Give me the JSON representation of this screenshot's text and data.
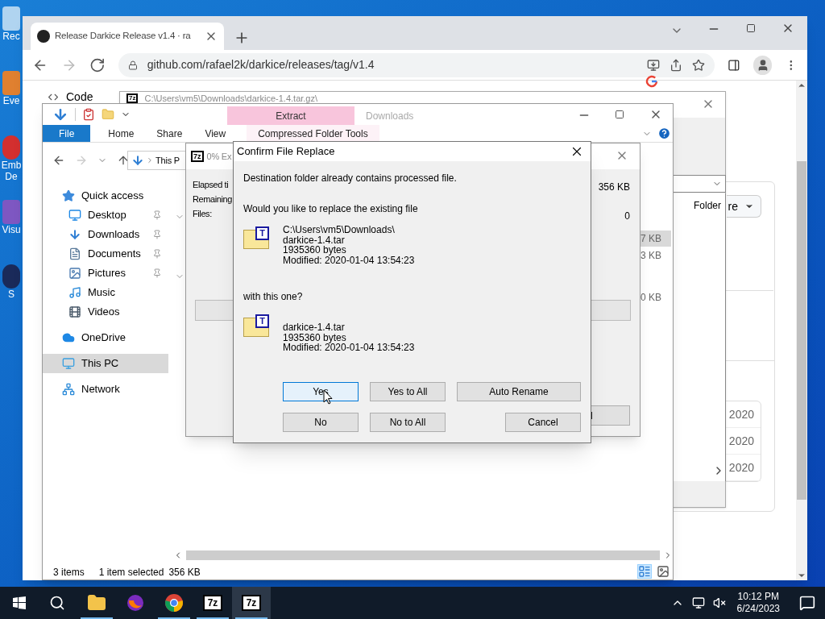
{
  "desktop_icons": [
    {
      "kind": "bin",
      "lines": [
        "Rec"
      ]
    },
    {
      "kind": "shortcut",
      "lines": [
        "Eve"
      ]
    },
    {
      "kind": "red",
      "lines": [
        "Emb",
        "De"
      ]
    },
    {
      "kind": "purple",
      "lines": [
        "Visu"
      ]
    },
    {
      "kind": "dark",
      "lines": [
        "S"
      ]
    }
  ],
  "browser": {
    "tab_title": "Release Darkice Release v1.4 · ra",
    "url": "github.com/rafael2k/darkice/releases/tag/v1.4",
    "code_tab": "Code",
    "dropdown_label": "re",
    "dates": [
      "2020",
      "2020",
      "2020"
    ]
  },
  "archive_manager": {
    "logo": "7z",
    "path": "C:\\Users\\vm5\\Downloads\\darkice-1.4.tar.gz\\",
    "column": "Folder"
  },
  "explorer": {
    "title": "Downloads",
    "context_tab": "Extract",
    "ribbon_tabs": [
      {
        "label": "File",
        "selected": true
      },
      {
        "label": "Home",
        "selected": false
      },
      {
        "label": "Share",
        "selected": false
      },
      {
        "label": "View",
        "selected": false
      },
      {
        "label": "Compressed Folder Tools",
        "selected": false
      }
    ],
    "address": "This P",
    "nav": [
      {
        "kind": "quick",
        "label": "Quick access",
        "selected": false,
        "children": [
          {
            "kind": "desktop",
            "label": "Desktop",
            "pinned": true,
            "selected": false
          },
          {
            "kind": "downloads",
            "label": "Downloads",
            "pinned": true,
            "selected": false
          },
          {
            "kind": "documents",
            "label": "Documents",
            "pinned": true,
            "selected": false
          },
          {
            "kind": "pictures",
            "label": "Pictures",
            "pinned": true,
            "selected": false
          },
          {
            "kind": "music",
            "label": "Music",
            "pinned": false,
            "selected": false
          },
          {
            "kind": "videos",
            "label": "Videos",
            "pinned": false,
            "selected": false
          }
        ]
      },
      {
        "kind": "onedrive",
        "label": "OneDrive",
        "selected": false
      },
      {
        "kind": "pc",
        "label": "This PC",
        "selected": true
      },
      {
        "kind": "network",
        "label": "Network",
        "selected": false
      }
    ],
    "sizes": [
      {
        "text": "7 KB",
        "selected": true
      },
      {
        "text": "3 KB",
        "selected": false
      },
      {
        "text": "0 KB",
        "selected": false
      }
    ],
    "status": {
      "count": "3 items",
      "selection": "1 item selected",
      "size": "356 KB"
    }
  },
  "progress": {
    "logo": "7z",
    "title": "0% Ex",
    "labels": [
      "Elapsed ti",
      "Remaining",
      "Files:"
    ],
    "values": [
      "356 KB",
      "0"
    ],
    "level": 0,
    "button": "l"
  },
  "dialog": {
    "title": "Confirm File Replace",
    "message": "Destination folder already contains processed file.",
    "question": "Would you like to replace the existing file",
    "existing": {
      "icon_letter": "T",
      "lines": [
        "C:\\Users\\vm5\\Downloads\\",
        "darkice-1.4.tar",
        "1935360 bytes",
        "Modified: 2020-01-04 13:54:23"
      ]
    },
    "with_text": "with this one?",
    "replacement": {
      "icon_letter": "T",
      "lines": [
        "darkice-1.4.tar",
        "1935360 bytes",
        "Modified: 2020-01-04 13:54:23"
      ]
    },
    "buttons": [
      {
        "label": "Yes",
        "focused": true
      },
      {
        "label": "Yes to All",
        "focused": false
      },
      {
        "label": "Auto Rename",
        "focused": false
      },
      {
        "label": "No",
        "focused": false
      },
      {
        "label": "No to All",
        "focused": false
      },
      {
        "label": "Cancel",
        "focused": false
      }
    ]
  },
  "taskbar": {
    "apps": [
      {
        "kind": "explorer",
        "open": true,
        "active": false
      },
      {
        "kind": "firefox",
        "open": false,
        "active": false
      },
      {
        "kind": "chrome",
        "open": true,
        "active": false
      },
      {
        "kind": "sevenzip",
        "logo": "7z",
        "open": true,
        "active": false
      },
      {
        "kind": "sevenzip",
        "logo": "7z",
        "open": true,
        "active": true
      }
    ],
    "time": "10:12 PM",
    "date": "6/24/2023"
  }
}
